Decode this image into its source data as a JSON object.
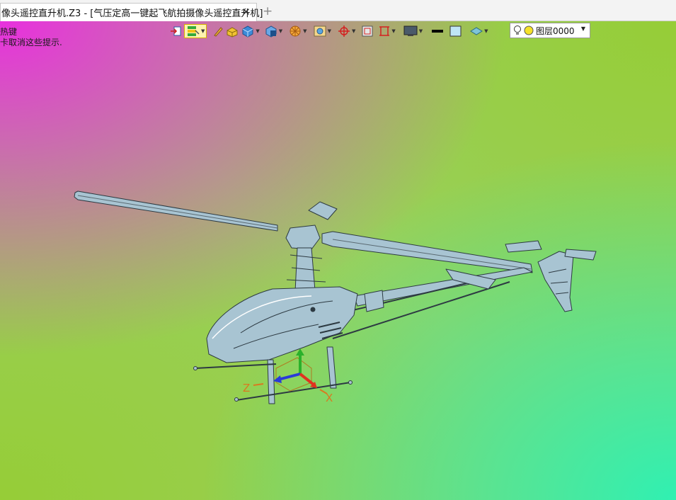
{
  "tab": {
    "title": "像头遥控直升机.Z3 - [气压定高一键起飞航拍摄像头遥控直升机]",
    "close": "✕",
    "add": "+"
  },
  "hints": {
    "line1": "热键",
    "line2": "卡取消这些提示."
  },
  "layer": {
    "name": "图层0000"
  },
  "axes": {
    "x": "X",
    "z": "Z"
  },
  "colors": {
    "model": "#a8c4d2",
    "edge": "#2d3a42",
    "x_axis": "#e0331f",
    "y_axis": "#2bb12b",
    "z_axis": "#2a3ad8",
    "background_corners": [
      "#e830de",
      "#96cd37",
      "#30f0b2"
    ]
  },
  "toolbar_icons": [
    "exit-icon",
    "filter-icon",
    "pencil-icon",
    "solid-box-icon",
    "shaded-cube-icon",
    "wire-cube-icon",
    "section-icon",
    "display-icon",
    "align-icon",
    "frame-icon",
    "view-select-icon",
    "screen-icon",
    "color-swatch-icon",
    "line-color-icon",
    "plane-icon",
    "bulb-icon"
  ]
}
